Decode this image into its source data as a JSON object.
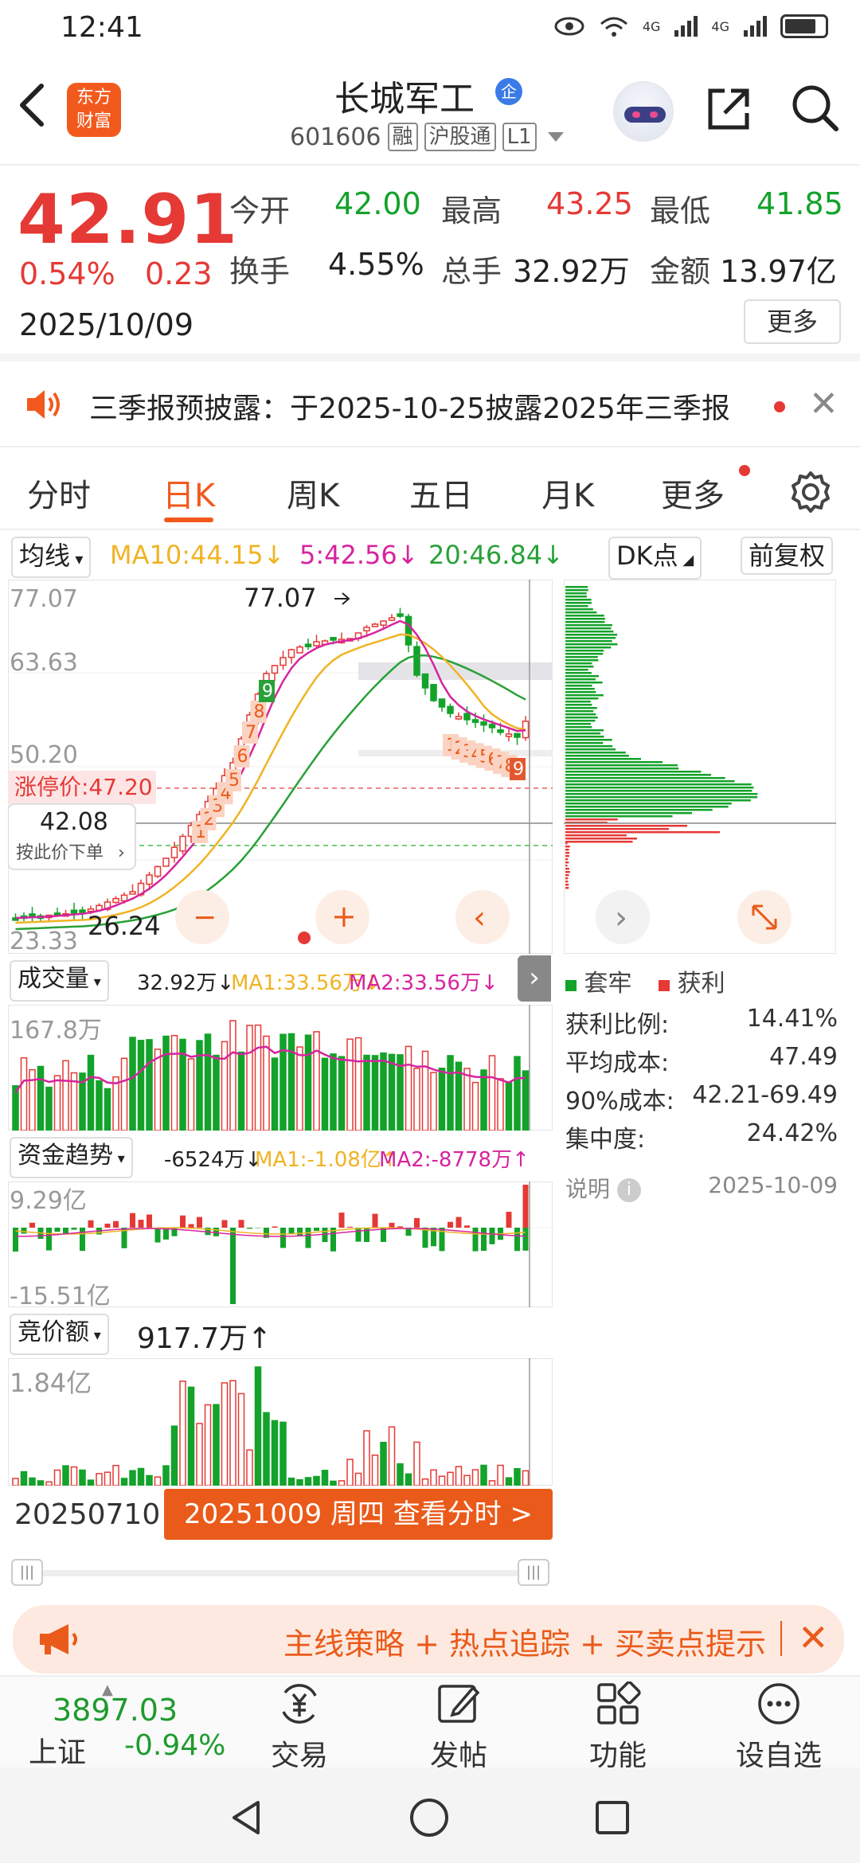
{
  "status_bar": {
    "time": "12:41",
    "signal_1": "4G",
    "signal_2": "4G"
  },
  "header": {
    "logo_line1": "东方",
    "logo_line2": "财富",
    "stock_name": "长城军工",
    "badge": "企",
    "stock_code": "601606",
    "tags": [
      "融",
      "沪股通",
      "L1"
    ]
  },
  "quote": {
    "price": "42.91",
    "change_pct": "0.54%",
    "change_amt": "0.23",
    "date": "2025/10/09",
    "open_label": "今开",
    "open": "42.00",
    "high_label": "最高",
    "high": "43.25",
    "low_label": "最低",
    "low": "41.85",
    "turnover_label": "换手",
    "turnover": "4.55%",
    "volume_label": "总手",
    "volume": "32.92万",
    "amount_label": "金额",
    "amount": "13.97亿",
    "more_label": "更多"
  },
  "notice": {
    "text": "三季报预披露：于2025-10-25披露2025年三季报"
  },
  "tabs": [
    "分时",
    "日K",
    "周K",
    "五日",
    "月K",
    "更多"
  ],
  "active_tab": "日K",
  "ma_row": {
    "selector": "均线",
    "ma10": "MA10:44.15↓",
    "ma5": "5:42.56↓",
    "ma20": "20:46.84↓",
    "dk": "DK点",
    "adjust": "前复权"
  },
  "colors": {
    "up": "#e53935",
    "down": "#13a22a",
    "accent": "#f25a1d",
    "ma5": "#d6249f",
    "ma10": "#f0b323",
    "ma20": "#28a137"
  },
  "main_chart": {
    "y_labels": [
      "77.07",
      "63.63",
      "50.20",
      "23.33"
    ],
    "high_marker": "77.07",
    "low_marker": "26.24",
    "limit_price_label": "涨停价:47.20",
    "crosshair_price": "42.08",
    "order_hint": "按此价下单",
    "zoom_out": "−",
    "zoom_in": "+",
    "prev": "‹",
    "next": "›",
    "td_counts_up": [
      "1",
      "2",
      "3",
      "4",
      "5",
      "6",
      "7",
      "8",
      "9"
    ],
    "td_counts_down": [
      "1",
      "2",
      "3",
      "4",
      "5",
      "6",
      "7",
      "8",
      "9"
    ]
  },
  "chip_distribution": {
    "legend_trapped": "套牢",
    "legend_profit": "获利",
    "stats": [
      {
        "label": "获利比例:",
        "value": "14.41%"
      },
      {
        "label": "平均成本:",
        "value": "47.49"
      },
      {
        "label": "90%成本:",
        "value": "42.21-69.49"
      },
      {
        "label": "集中度:",
        "value": "24.42%"
      }
    ],
    "note_label": "说明",
    "note_date": "2025-10-09"
  },
  "volume_panel": {
    "selector": "成交量",
    "value": "32.92万↓",
    "ma1": "MA1:33.56万↓",
    "ma2": "MA2:33.56万↓",
    "y_label": "167.8万"
  },
  "fund_panel": {
    "selector": "资金趋势",
    "value": "-6524万↓",
    "ma1": "MA1:-1.08亿↑",
    "ma2": "MA2:-8778万↑",
    "y_top": "9.29亿",
    "y_bottom": "-15.51亿"
  },
  "bid_panel": {
    "selector": "竞价额",
    "value": "917.7万↑",
    "y_label": "1.84亿"
  },
  "date_row": {
    "start_date": "20250710",
    "pill_text": "20251009 周四 查看分时 >"
  },
  "promo": {
    "text": "主线策略 + 热点追踪 + 买卖点提示"
  },
  "bottom_nav": {
    "index_value": "3897.03",
    "index_name": "上证",
    "index_change": "-0.94%",
    "items": [
      "交易",
      "发帖",
      "功能",
      "设自选"
    ]
  }
}
